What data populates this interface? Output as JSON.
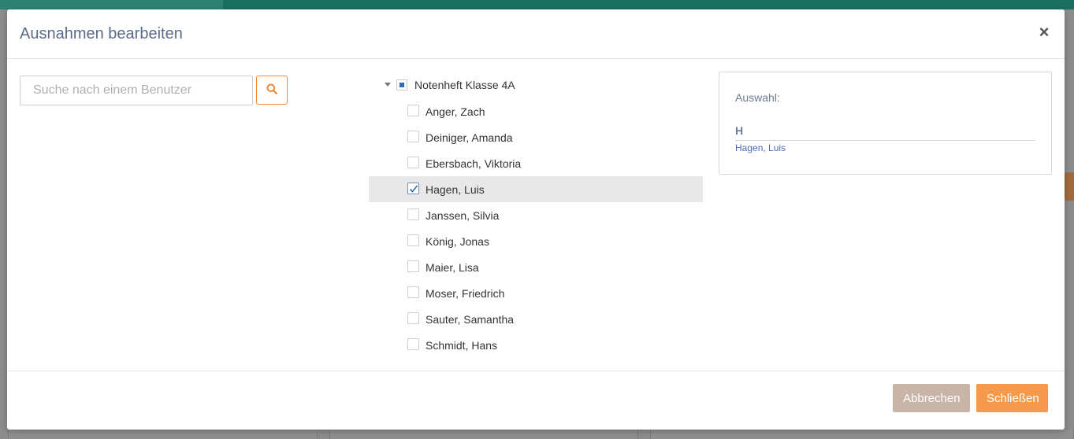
{
  "dialog": {
    "title": "Ausnahmen bearbeiten",
    "close_label": "×"
  },
  "search": {
    "placeholder": "Suche nach einem Benutzer",
    "value": ""
  },
  "tree": {
    "root_label": "Notenheft Klasse 4A",
    "root_state": "partial",
    "items": [
      {
        "label": "Anger, Zach",
        "checked": false
      },
      {
        "label": "Deiniger, Amanda",
        "checked": false
      },
      {
        "label": "Ebersbach, Viktoria",
        "checked": false
      },
      {
        "label": "Hagen, Luis",
        "checked": true
      },
      {
        "label": "Janssen, Silvia",
        "checked": false
      },
      {
        "label": "König, Jonas",
        "checked": false
      },
      {
        "label": "Maier, Lisa",
        "checked": false
      },
      {
        "label": "Moser, Friedrich",
        "checked": false
      },
      {
        "label": "Sauter, Samantha",
        "checked": false
      },
      {
        "label": "Schmidt, Hans",
        "checked": false
      }
    ]
  },
  "selection": {
    "title": "Auswahl:",
    "group_letter": "H",
    "items": [
      "Hagen, Luis"
    ]
  },
  "footer": {
    "cancel_label": "Abbrechen",
    "close_label": "Schließen"
  },
  "colors": {
    "accent": "#f5994a",
    "cancel": "#c8b5a8",
    "title": "#5a6b85",
    "link": "#4f6bb0"
  },
  "icons": {
    "search": "search-icon",
    "close": "close-icon",
    "caret": "caret-down-icon",
    "check": "checkmark-icon"
  }
}
